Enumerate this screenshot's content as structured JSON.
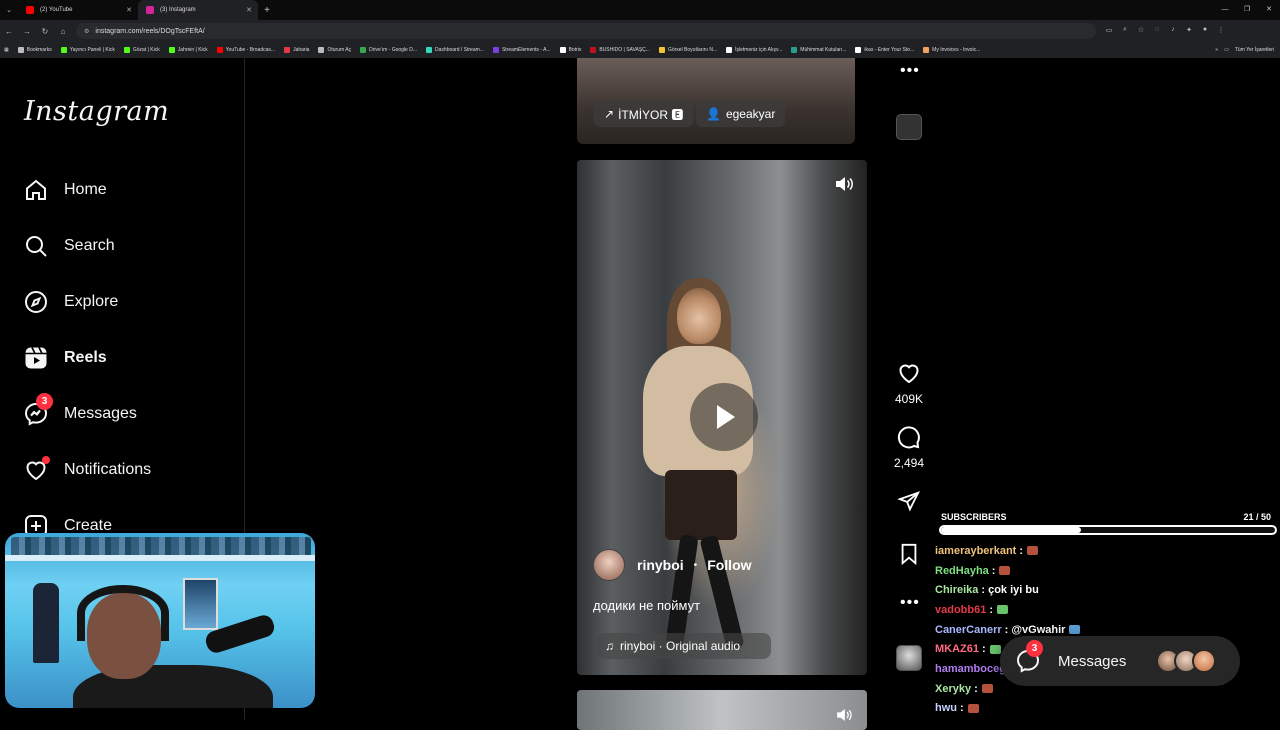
{
  "browser": {
    "tabs": [
      {
        "title": "(2) YouTube",
        "favicon_color": "#ff0000",
        "active": false
      },
      {
        "title": "(3) Instagram",
        "favicon_color": "#d6249f",
        "active": true
      }
    ],
    "url": "instagram.com/reels/DOgTscFEftA/",
    "bookmarks": [
      {
        "label": "Bookmarks",
        "color": "#bbbbbb"
      },
      {
        "label": "Yayıncı Paneli | Kick",
        "color": "#53fc18"
      },
      {
        "label": "Gözat | Kick",
        "color": "#53fc18"
      },
      {
        "label": "Jahrein | Kick",
        "color": "#53fc18"
      },
      {
        "label": "YouTube - Broadcas...",
        "color": "#ff0000"
      },
      {
        "label": "Jaharia",
        "color": "#e63946"
      },
      {
        "label": "Oturum Aç",
        "color": "#bbbbbb"
      },
      {
        "label": "Drive'ım - Google D...",
        "color": "#34a853"
      },
      {
        "label": "Dashboard / Stream...",
        "color": "#35d6c0"
      },
      {
        "label": "StreamElements - A...",
        "color": "#7b3fe4"
      },
      {
        "label": "Botrix",
        "color": "#ffffff"
      },
      {
        "label": "BUSHIDO | SAVAŞÇ...",
        "color": "#c1121f"
      },
      {
        "label": "Görsel Boyutlarını N...",
        "color": "#f4c430"
      },
      {
        "label": "İşletmeniz için Alışv...",
        "color": "#ffffff"
      },
      {
        "label": "Mühimmat Kutuları...",
        "color": "#2a9d8f"
      },
      {
        "label": "ikas - Enter Your Sto...",
        "color": "#ffffff"
      },
      {
        "label": "My Invoices - Invoic...",
        "color": "#f4a261"
      }
    ],
    "bookmarks_right": "Tüm Yer İşaretleri"
  },
  "sidebar": {
    "logo": "Instagram",
    "items": [
      {
        "label": "Home",
        "icon": "home-icon"
      },
      {
        "label": "Search",
        "icon": "search-icon"
      },
      {
        "label": "Explore",
        "icon": "compass-icon"
      },
      {
        "label": "Reels",
        "icon": "reels-icon"
      },
      {
        "label": "Messages",
        "icon": "messenger-icon",
        "badge": "3"
      },
      {
        "label": "Notifications",
        "icon": "heart-icon"
      },
      {
        "label": "Create",
        "icon": "plus-square-icon"
      }
    ]
  },
  "reels": {
    "top_chips": {
      "left": "İTMİYOR 🅴",
      "right": "egeakyar"
    },
    "main": {
      "author": "rinyboi",
      "separator": "•",
      "follow": "Follow",
      "caption": "додики не поймут",
      "audio": "rinyboi · Original audio"
    },
    "actions": {
      "likes": "409K",
      "comments": "2,494"
    }
  },
  "stream_overlay": {
    "subs_label": "SUBSCRIBERS",
    "subs_count": "21  / 50",
    "subs_progress": 0.42,
    "chat": [
      {
        "user": "iamerayberkant",
        "color": "#f0c27b",
        "text": "",
        "emote_color": "#b5523b"
      },
      {
        "user": "RedHayha",
        "color": "#7ee081",
        "text": "",
        "emote_color": "#b5523b"
      },
      {
        "user": "Chireika",
        "color": "#a8e6a1",
        "text": "çok iyi bu",
        "emote_color": ""
      },
      {
        "user": "vadobb61",
        "color": "#e6394a",
        "text": "",
        "emote_color": "#69c46b"
      },
      {
        "user": "CanerCanerr",
        "color": "#aab8ff",
        "text": "@vGwahir",
        "emote_color": "#5aa0d8"
      },
      {
        "user": "MKAZ61",
        "color": "#ff6b81",
        "text": "",
        "emote_color": "#69c46b"
      },
      {
        "user": "hamamboceg",
        "color": "#b07cf0",
        "text": "",
        "emote_color": ""
      },
      {
        "user": "Xeryky",
        "color": "#a8e6a1",
        "text": "",
        "emote_color": "#b5523b"
      },
      {
        "user": "hwu",
        "color": "#c7d2ff",
        "text": "",
        "emote_color": "#b5523b"
      }
    ]
  },
  "messages_pill": {
    "label": "Messages",
    "badge": "3"
  }
}
